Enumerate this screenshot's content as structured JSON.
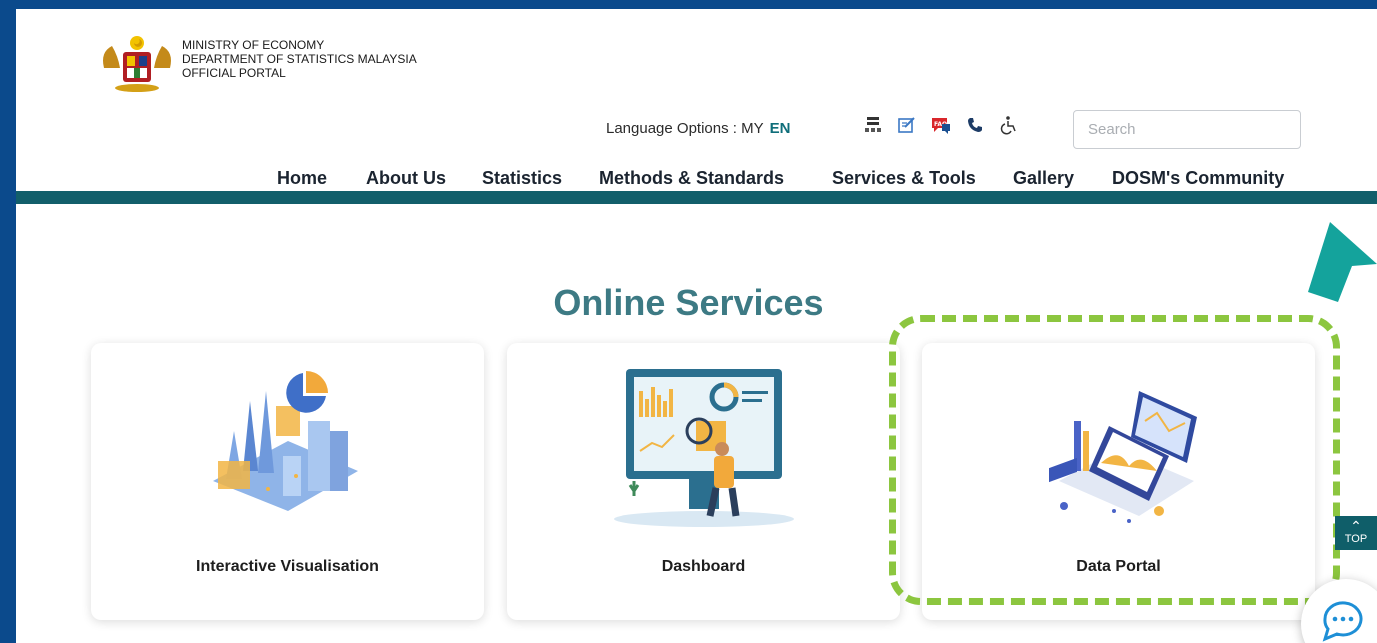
{
  "header": {
    "org_lines": [
      "MINISTRY OF ECONOMY",
      "DEPARTMENT OF STATISTICS MALAYSIA",
      "OFFICIAL PORTAL"
    ],
    "language_label": "Language Options : MY",
    "language_active": "EN",
    "search_placeholder": "Search",
    "tools": [
      "sitemap-icon",
      "feedback-icon",
      "faq-icon",
      "phone-icon",
      "accessibility-icon"
    ]
  },
  "nav": {
    "items": [
      "Home",
      "About Us",
      "Statistics",
      "Methods & Standards",
      "Services & Tools",
      "Gallery",
      "DOSM's Community"
    ]
  },
  "main": {
    "section_title": "Online Services",
    "cards": [
      {
        "label": "Interactive Visualisation",
        "icon": "interactive-visualisation-illustration"
      },
      {
        "label": "Dashboard",
        "icon": "dashboard-illustration"
      },
      {
        "label": "Data Portal",
        "icon": "data-portal-illustration"
      }
    ]
  },
  "floating": {
    "top_label": "TOP",
    "chat_icon": "chat-icon"
  },
  "colors": {
    "frame": "#0b4a8c",
    "nav_bar": "#125f6b",
    "title": "#3d7a84",
    "highlight": "#8cc63f",
    "language_active": "#0f6e7a"
  }
}
